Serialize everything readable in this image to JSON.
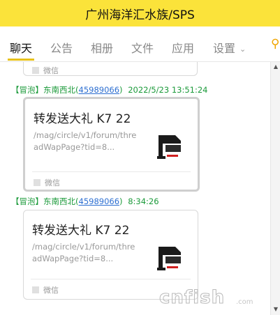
{
  "window": {
    "title": "广州海洋汇水族/SPS"
  },
  "tabs": [
    {
      "label": "聊天"
    },
    {
      "label": "公告"
    },
    {
      "label": "相册"
    },
    {
      "label": "文件"
    },
    {
      "label": "应用"
    },
    {
      "label": "设置"
    }
  ],
  "messages": [
    {
      "source": "微信"
    },
    {
      "prefix": "【冒泡】东南西北(",
      "qq": "45989066",
      "suffix": ")",
      "time": "2022/5/23 13:51:24",
      "card_title": "转发送大礼 K7 22",
      "card_url": "/mag/circle/v1/forum/threadWapPage?tid=8...",
      "source": "微信"
    },
    {
      "prefix": "【冒泡】东南西北(",
      "qq": "45989066",
      "suffix": ")",
      "time": "8:34:26",
      "card_title": "转发送大礼 K7 22",
      "card_url": "/mag/circle/v1/forum/threadWapPage?tid=8...",
      "source": "微信"
    }
  ],
  "watermark": {
    "text": "cnfish",
    "suffix": ".com"
  },
  "colors": {
    "titlebar": "#fbe33a",
    "meta_green": "#1b9a3a",
    "link_blue": "#2d6fd1"
  }
}
